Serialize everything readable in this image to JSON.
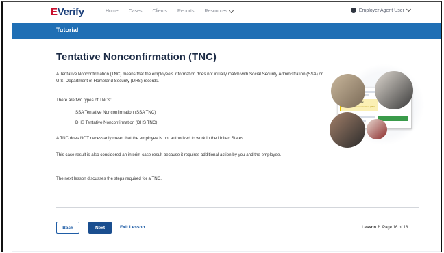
{
  "nav": {
    "logo_e": "E",
    "logo_verify": "Verify",
    "links": [
      "Home",
      "Cases",
      "Clients",
      "Reports"
    ],
    "resources": "Resources",
    "user": "Employer Agent User"
  },
  "banner": {
    "title": "Tutorial"
  },
  "main": {
    "heading": "Tentative Nonconfirmation (TNC)",
    "p1": "A Tentative Nonconfirmation (TNC) means that the employee's information does not initially match with Social Security Administration (SSA) or U.S. Department of Homeland Security (DHS) records.",
    "p2": "There are two types of TNCs:",
    "types": [
      "SSA Tentative Nonconfirmation (SSA TNC)",
      "DHS Tentative Nonconfirmation (DHS TNC)"
    ],
    "p3": "A TNC does NOT necessarily mean that the employee is not authorized to work in the United States.",
    "p4": "This case result is also considered an interim case result because it requires additional action by you and the employee.",
    "p5": "The next lesson discusses the steps required for a TNC."
  },
  "illustration": {
    "card_label": "Employment Eligibility:",
    "card_status": "SSA Tentative Nonconfirmation (TNC)"
  },
  "footer": {
    "back": "Back",
    "next": "Next",
    "exit": "Exit Lesson",
    "lesson": "Lesson 2",
    "page": "Page 16 of 18"
  },
  "colors": {
    "brand_blue": "#1f6fb5",
    "button_blue": "#1a4e8f",
    "logo_red": "#c8102e"
  }
}
